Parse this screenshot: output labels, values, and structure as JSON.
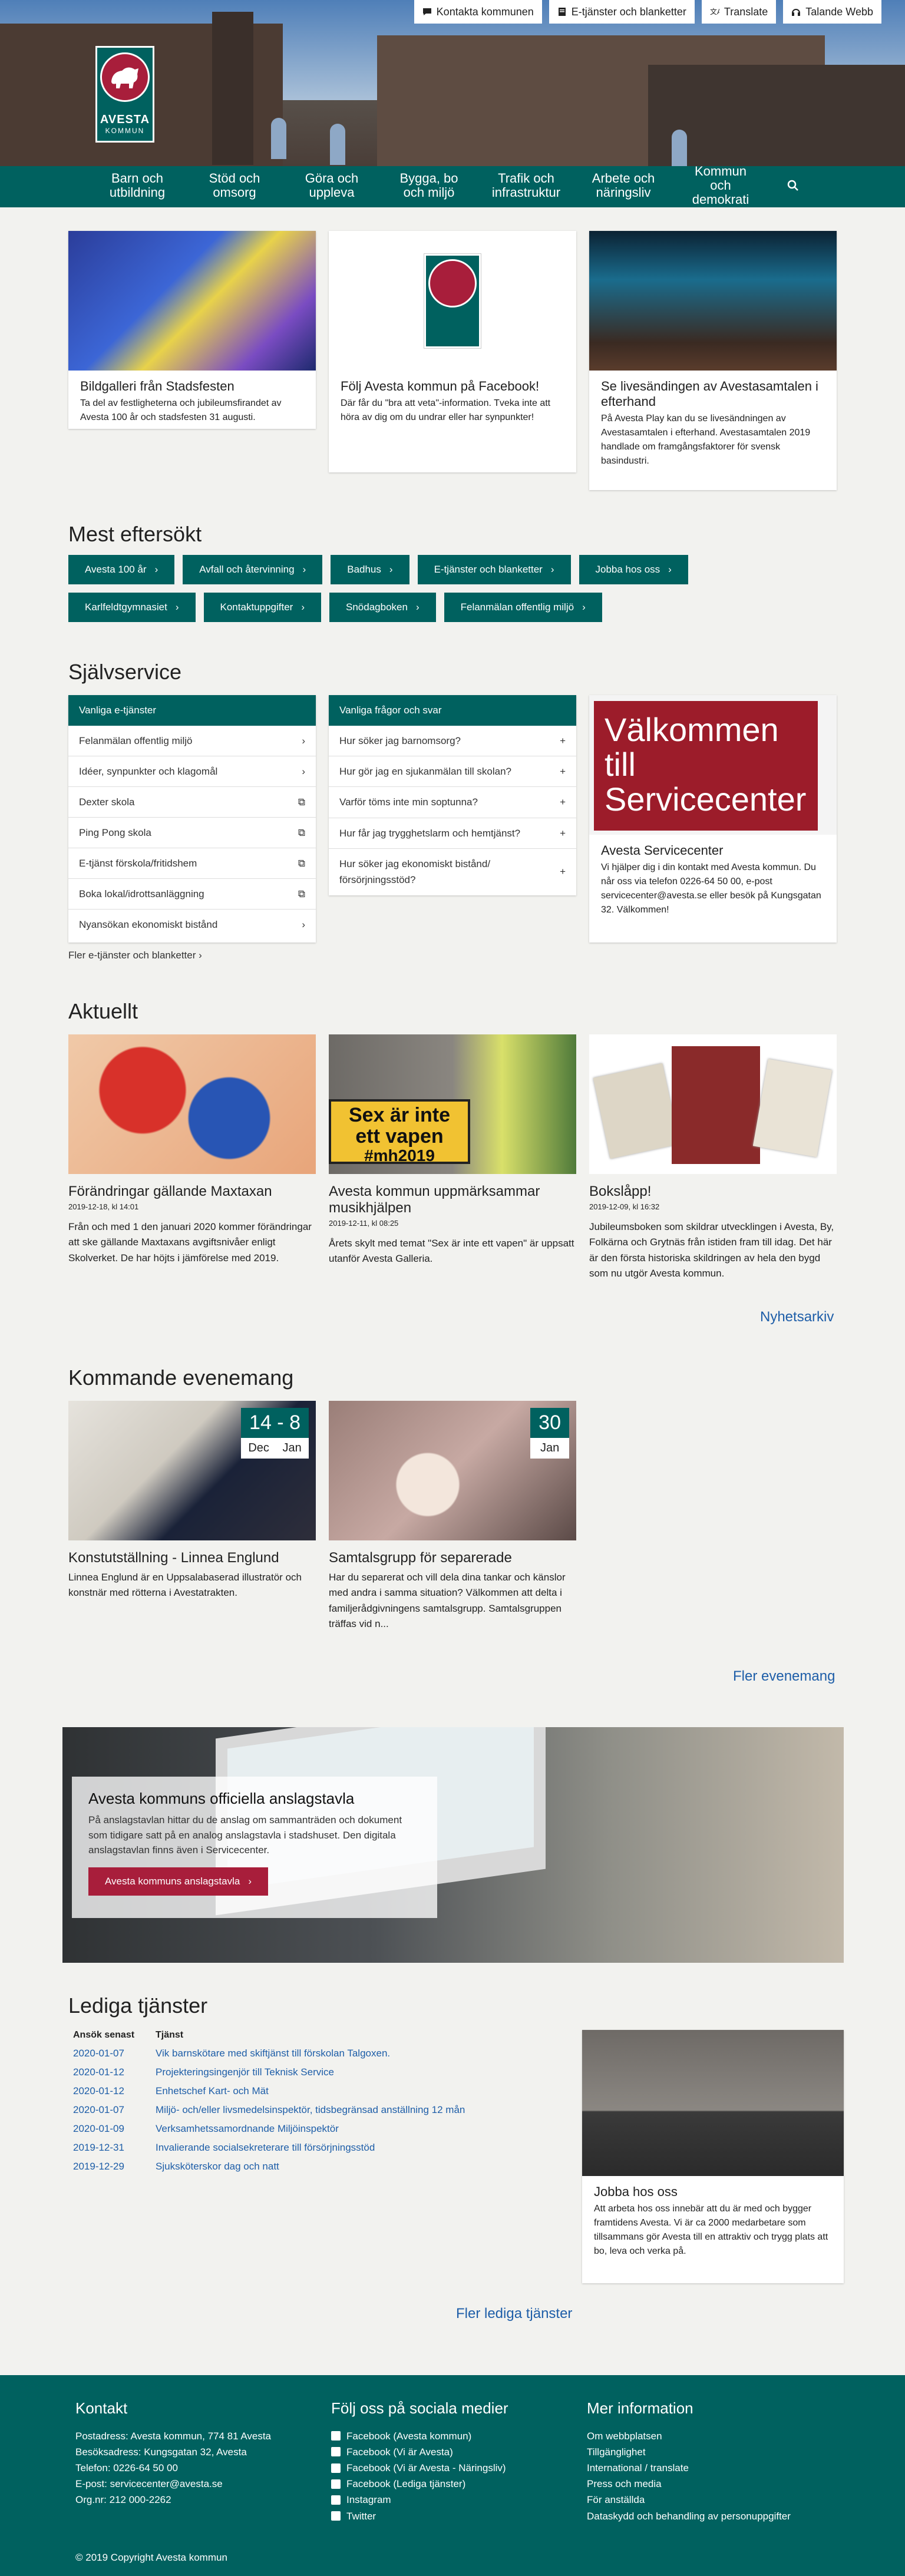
{
  "topbar": {
    "contact": "Kontakta kommunen",
    "eservices": "E-tjänster och blanketter",
    "translate": "Translate",
    "talande": "Talande Webb"
  },
  "logo": {
    "name": "AVESTA",
    "sub": "KOMMUN"
  },
  "nav": [
    "Barn och utbildning",
    "Stöd och omsorg",
    "Göra och uppleva",
    "Bygga, bo och miljö",
    "Trafik och infrastruktur",
    "Arbete och näringsliv",
    "Kommun och demokrati"
  ],
  "top_cards": [
    {
      "title": "Bildgalleri från Stadsfesten",
      "text": "Ta del av festligheterna och jubileumsfirandet av Avesta 100 år och stadsfesten 31 augusti."
    },
    {
      "title": "Följ Avesta kommun på Facebook!",
      "text": "Där får du \"bra att veta\"-information. Tveka inte att höra av dig om du undrar eller har synpunkter!"
    },
    {
      "title": "Se livesändingen av Avestasamtalen i efterhand",
      "text": "På Avesta Play kan du se livesändningen av Avestasamtalen i efterhand. Avestasamtalen 2019 handlade om framgångsfaktorer för svensk basindustri."
    }
  ],
  "most_searched": {
    "title": "Mest eftersökt",
    "items": [
      "Avesta 100 år",
      "Avfall och återvinning",
      "Badhus",
      "E-tjänster och blanketter",
      "Jobba hos oss",
      "Karlfeldtgymnasiet",
      "Kontaktuppgifter",
      "Snödagboken",
      "Felanmälan offentlig miljö"
    ]
  },
  "selfservice": {
    "title": "Självservice",
    "eservices_head": "Vanliga e-tjänster",
    "eservices": [
      "Felanmälan offentlig miljö",
      "Idéer, synpunkter och klagomål",
      "Dexter skola",
      "Ping Pong skola",
      "E-tjänst förskola/fritidshem",
      "Boka lokal/idrottsanläggning",
      "Nyansökan ekonomiskt bistånd"
    ],
    "more": "Fler e-tjänster och blanketter",
    "faq_head": "Vanliga frågor och svar",
    "faq": [
      "Hur söker jag barnomsorg?",
      "Hur gör jag en sjukanmälan till skolan?",
      "Varför töms inte min soptunna?",
      "Hur får jag trygghetslarm och hemtjänst?",
      "Hur söker jag ekonomiskt bistånd/ försörjningsstöd?"
    ],
    "service_title": "Avesta Servicecenter",
    "service_text": "Vi hjälper dig i din kontakt med Avesta kommun. Du når oss via telefon 0226-64 50 00, e-post servicecenter@avesta.se eller besök på Kungsgatan 32. Välkommen!",
    "sign1": "Välkommen till",
    "sign2": "Servicecenter"
  },
  "news": {
    "title": "Aktuellt",
    "items": [
      {
        "title": "Förändringar gällande Maxtaxan",
        "date": "2019-12-18, kl 14:01",
        "text": "Från och med 1 den januari 2020 kommer förändringar att ske gällande Maxtaxans avgiftsnivåer enligt Skolverket. De har höjts i jämförelse med 2019."
      },
      {
        "title": "Avesta kommun uppmärksammar musikhjälpen",
        "date": "2019-12-11, kl 08:25",
        "text": "Årets skylt med temat \"Sex är inte ett vapen\" är uppsatt utanför Avesta Galleria."
      },
      {
        "title": "Bokslåpp!",
        "date": "2019-12-09, kl 16:32",
        "text": "Jubileumsboken som skildrar utvecklingen i Avesta, By, Folkärna och Grytnäs från istiden fram till idag. Det här är den första historiska skildringen av hela den bygd som nu utgör Avesta kommun."
      }
    ],
    "sign1": "Sex är inte",
    "sign2": "ett vapen",
    "sign3": "#mh2019",
    "archive": "Nyhetsarkiv"
  },
  "events": {
    "title": "Kommande evenemang",
    "items": [
      {
        "title": "Konstutställning - Linnea Englund",
        "days": "14 - 8",
        "m1": "Dec",
        "m2": "Jan",
        "text": "Linnea Englund är en Uppsalabaserad illustratör och konstnär med rötterna i Avestatrakten."
      },
      {
        "title": "Samtalsgrupp för separerade",
        "days": "30",
        "m1": "Jan",
        "m2": "",
        "text": "Har du separerat och vill dela dina tankar och känslor med andra i samma situation? Välkommen att delta i familjerådgivningens samtalsgrupp. Samtalsgruppen träffas vid n..."
      }
    ],
    "more": "Fler evenemang"
  },
  "board": {
    "title": "Avesta kommuns officiella anslagstavla",
    "text": "På anslagstavlan hittar du de anslag om sammanträden och dokument som tidigare satt på en analog anslagstavla i stadshuset. Den digitala anslagstavlan finns även i Servicecenter.",
    "button": "Avesta kommuns anslagstavla"
  },
  "jobs": {
    "title": "Lediga tjänster",
    "col_date": "Ansök senast",
    "col_title": "Tjänst",
    "rows": [
      {
        "date": "2020-01-07",
        "title": "Vik barnskötare med skiftjänst till förskolan Talgoxen."
      },
      {
        "date": "2020-01-12",
        "title": "Projekteringsingenjör till Teknisk Service"
      },
      {
        "date": "2020-01-12",
        "title": "Enhetschef Kart- och Mät"
      },
      {
        "date": "2020-01-07",
        "title": "Miljö- och/eller livsmedelsinspektör, tidsbegränsad anställning 12 mån"
      },
      {
        "date": "2020-01-09",
        "title": "Verksamhetssamordnande Miljöinspektör"
      },
      {
        "date": "2019-12-31",
        "title": "Invalierande socialsekreterare till försörjningsstöd"
      },
      {
        "date": "2019-12-29",
        "title": "Sjuksköterskor dag och natt"
      }
    ],
    "card_title": "Jobba hos oss",
    "card_text": "Att arbeta hos oss innebär att du är med och bygger framtidens Avesta. Vi är ca 2000 medarbetare som tillsammans gör Avesta till en attraktiv och trygg plats att bo, leva och verka på.",
    "more": "Fler lediga tjänster"
  },
  "footer": {
    "contact_title": "Kontakt",
    "contact": [
      "Postadress: Avesta kommun, 774 81 Avesta",
      "Besöksadress: Kungsgatan 32, Avesta",
      "Telefon: 0226-64 50 00",
      "E-post: servicecenter@avesta.se",
      "Org.nr: 212 000-2262"
    ],
    "social_title": "Följ oss på sociala medier",
    "social": [
      "Facebook (Avesta kommun)",
      "Facebook (Vi är Avesta)",
      "Facebook (Vi är Avesta - Näringsliv)",
      "Facebook (Lediga tjänster)",
      "Instagram",
      "Twitter"
    ],
    "info_title": "Mer information",
    "info": [
      "Om webbplatsen",
      "Tillgänglighet",
      "International / translate",
      "Press och media",
      "För anställda",
      "Dataskydd och behandling av personuppgifter"
    ],
    "copyright": "© 2019 Copyright",
    "copyright_link": "Avesta kommun"
  },
  "colors": {
    "primary": "#00615f",
    "accent": "#a81e3b",
    "link": "#1e5ea8"
  }
}
